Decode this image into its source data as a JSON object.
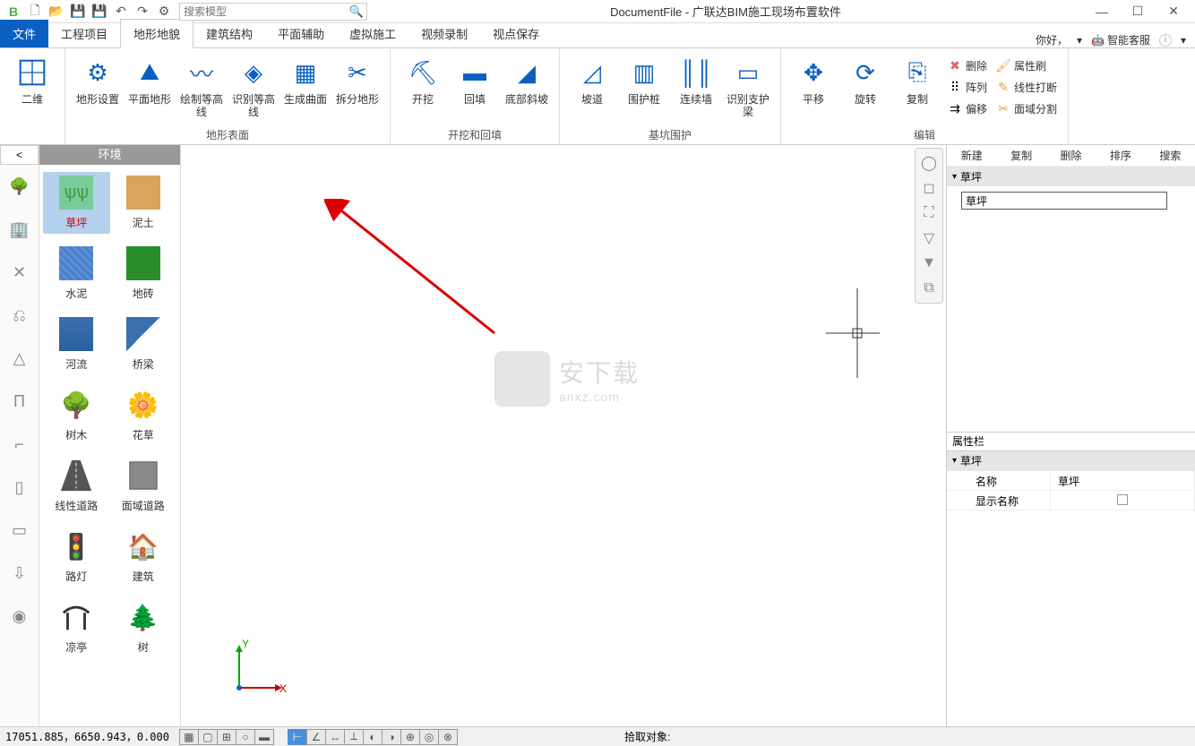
{
  "titlebar": {
    "search_placeholder": "搜索模型",
    "title": "DocumentFile - 广联达BIM施工现场布置软件"
  },
  "tabs": {
    "file": "文件",
    "items": [
      "工程项目",
      "地形地貌",
      "建筑结构",
      "平面辅助",
      "虚拟施工",
      "视频录制",
      "视点保存"
    ],
    "active_index": 1,
    "greeting": "你好，",
    "support": "智能客服"
  },
  "ribbon": {
    "groups": [
      {
        "label": "",
        "items": [
          {
            "text": "二维",
            "icon": "grid"
          }
        ]
      },
      {
        "label": "地形表面",
        "items": [
          {
            "text": "地形设置",
            "icon": "gear-terrain"
          },
          {
            "text": "平面地形",
            "icon": "mountain"
          },
          {
            "text": "绘制等高线",
            "icon": "contour"
          },
          {
            "text": "识别等高线",
            "icon": "scan-contour"
          },
          {
            "text": "生成曲面",
            "icon": "surface"
          },
          {
            "text": "拆分地形",
            "icon": "split"
          }
        ]
      },
      {
        "label": "开挖和回填",
        "items": [
          {
            "text": "开挖",
            "icon": "dig"
          },
          {
            "text": "回填",
            "icon": "fill"
          },
          {
            "text": "底部斜坡",
            "icon": "slope"
          }
        ]
      },
      {
        "label": "基坑围护",
        "items": [
          {
            "text": "坡道",
            "icon": "ramp"
          },
          {
            "text": "围护桩",
            "icon": "pile"
          },
          {
            "text": "连续墙",
            "icon": "wall"
          },
          {
            "text": "识别支护梁",
            "icon": "beam"
          }
        ]
      },
      {
        "label": "编辑",
        "items": [
          {
            "text": "平移",
            "icon": "move"
          },
          {
            "text": "旋转",
            "icon": "rotate"
          },
          {
            "text": "复制",
            "icon": "copy"
          }
        ],
        "small": [
          {
            "text": "删除",
            "icon": "delete",
            "color": "#d66"
          },
          {
            "text": "阵列",
            "icon": "array"
          },
          {
            "text": "偏移",
            "icon": "offset"
          },
          {
            "text": "属性刷",
            "icon": "brush",
            "color": "#e8a040"
          },
          {
            "text": "线性打断",
            "icon": "break",
            "color": "#e8a040"
          },
          {
            "text": "面域分割",
            "icon": "divide",
            "color": "#e8a040"
          }
        ]
      }
    ]
  },
  "leftbar_categories": [
    "tree",
    "building",
    "truss",
    "crane",
    "mountain2",
    "column",
    "pipe",
    "safety",
    "wall2",
    "excavate",
    "stage"
  ],
  "env": {
    "title": "环境",
    "items": [
      {
        "label": "草坪",
        "icon": "grass",
        "selected": true
      },
      {
        "label": "泥土",
        "icon": "soil"
      },
      {
        "label": "水泥",
        "icon": "cement"
      },
      {
        "label": "地砖",
        "icon": "tile"
      },
      {
        "label": "河流",
        "icon": "river"
      },
      {
        "label": "桥梁",
        "icon": "bridge"
      },
      {
        "label": "树木",
        "icon": "forest"
      },
      {
        "label": "花草",
        "icon": "flower"
      },
      {
        "label": "线性道路",
        "icon": "road"
      },
      {
        "label": "面域道路",
        "icon": "area-road"
      },
      {
        "label": "路灯",
        "icon": "lamp"
      },
      {
        "label": "建筑",
        "icon": "house"
      },
      {
        "label": "凉亭",
        "icon": "pavilion"
      },
      {
        "label": "树",
        "icon": "pine"
      }
    ]
  },
  "axis": {
    "x": "X",
    "y": "Y"
  },
  "watermark": {
    "text": "安下载",
    "sub": "anxz.com"
  },
  "rpanel": {
    "actions": [
      "新建",
      "复制",
      "删除",
      "排序",
      "搜索"
    ],
    "tree_title": "草坪",
    "tree_value": "草坪",
    "prop_title": "属性栏",
    "prop_head": "草坪",
    "rows": [
      {
        "k": "名称",
        "v": "草坪"
      },
      {
        "k": "显示名称",
        "v": ""
      }
    ]
  },
  "status": {
    "coord": "17051.885，6650.943，0.000",
    "pick": "拾取对象:"
  }
}
